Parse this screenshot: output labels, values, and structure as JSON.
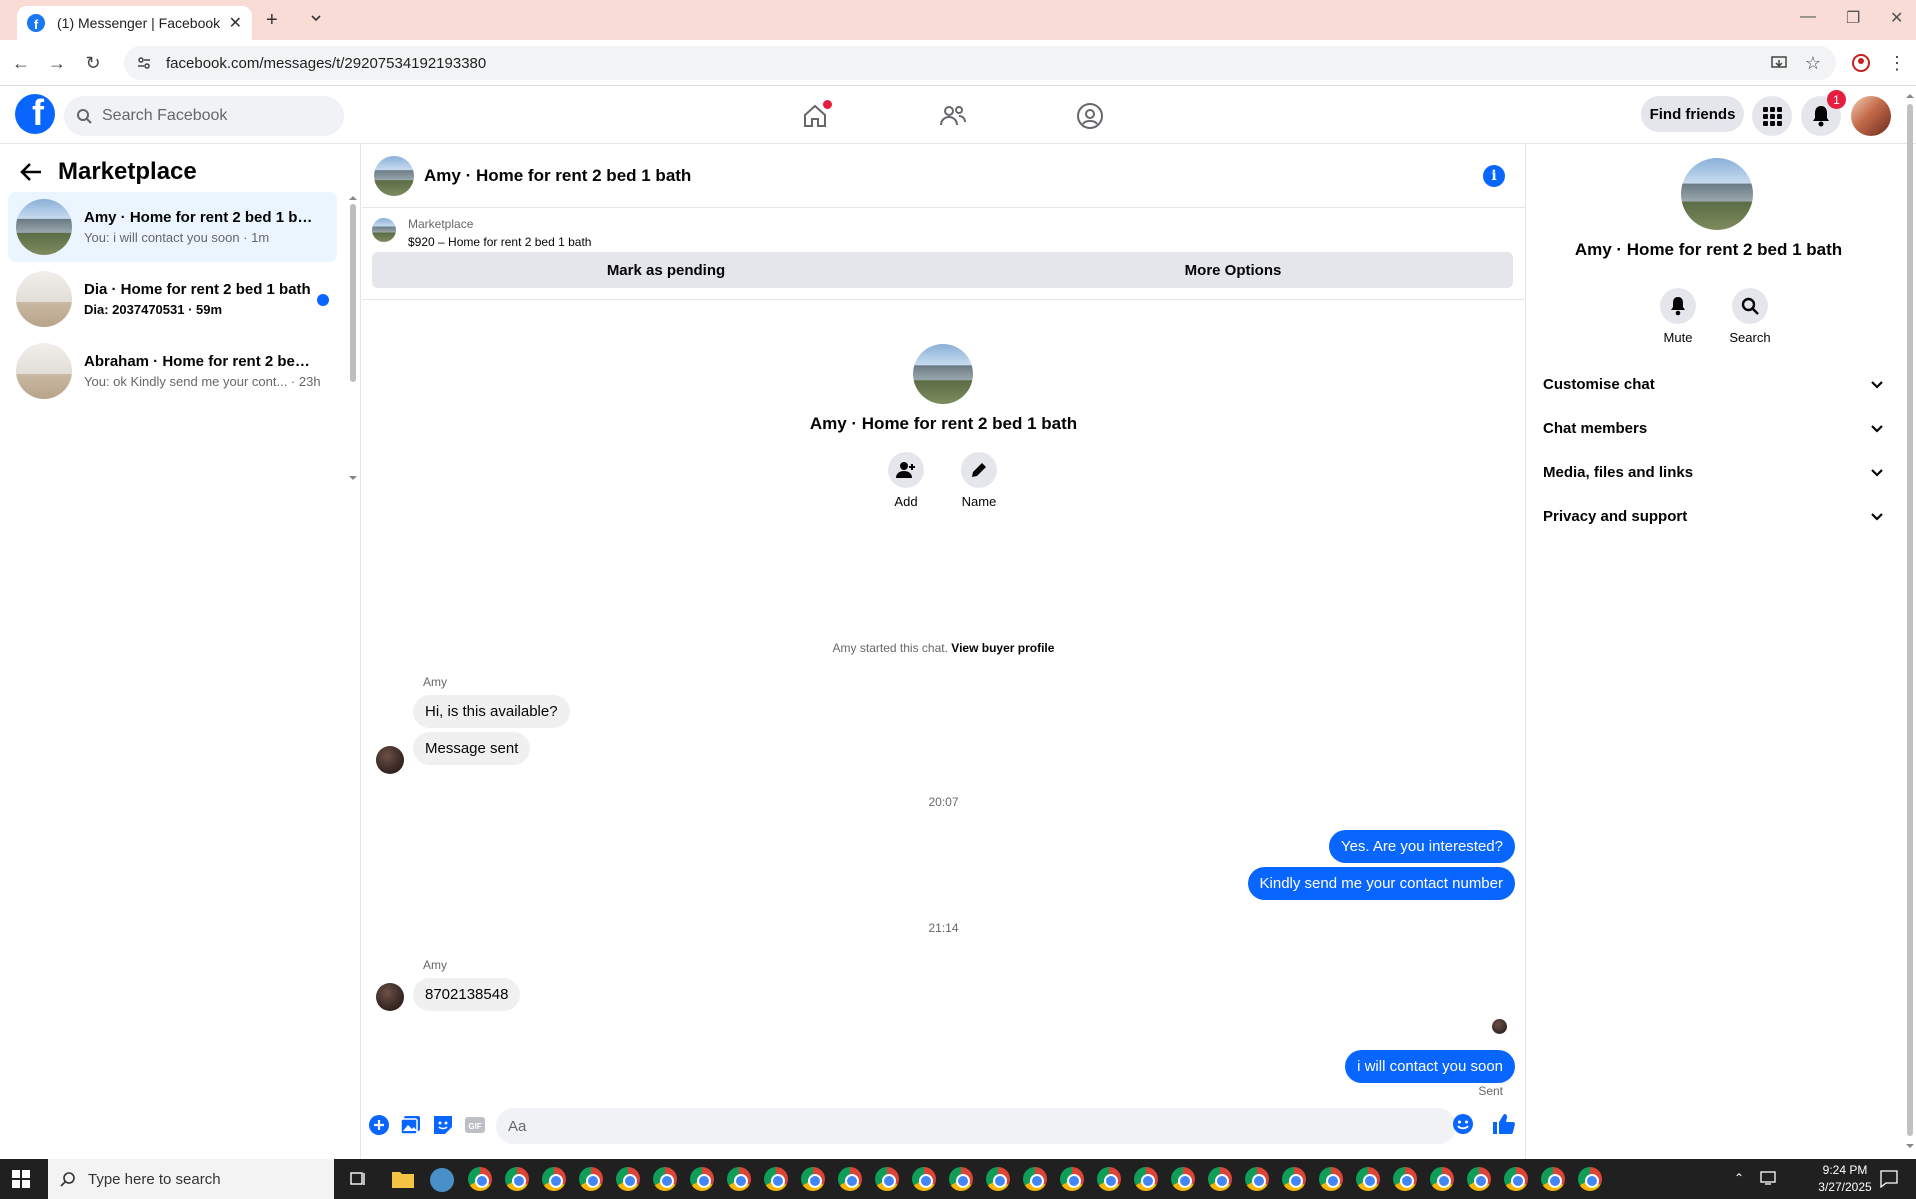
{
  "browser": {
    "tab_title": "(1) Messenger | Facebook",
    "url": "facebook.com/messages/t/29207534192193380"
  },
  "header": {
    "search_placeholder": "Search Facebook",
    "find_friends": "Find friends",
    "notification_count": "1"
  },
  "sidebar": {
    "title": "Marketplace",
    "conversations": [
      {
        "name": "Amy · Home for rent 2 bed 1 bath",
        "preview": "You: i will contact you soon · 1m",
        "active": true,
        "unread": false
      },
      {
        "name": "Dia · Home for rent 2 bed 1 bath",
        "preview": "Dia: 2037470531 · 59m",
        "active": false,
        "unread": true
      },
      {
        "name": "Abraham · Home for rent 2 bed ...",
        "preview": "You: ok Kindly send me your cont... · 23h",
        "active": false,
        "unread": false
      }
    ]
  },
  "chat": {
    "title": "Amy · Home for rent 2 bed 1 bath",
    "marketplace_label": "Marketplace",
    "listing": "$920 – Home for rent 2 bed 1 bath",
    "mark_pending": "Mark as pending",
    "more_options": "More Options",
    "intro_name": "Amy · Home for rent 2 bed 1 bath",
    "add_label": "Add",
    "name_label": "Name",
    "started_text": "Amy started this chat.",
    "buyer_profile": "View buyer profile",
    "sender_name": "Amy",
    "messages": {
      "m1": "Hi, is this available?",
      "m2": "Message sent",
      "time1": "20:07",
      "m3": "Yes. Are you interested?",
      "m4": "Kindly send me your contact number",
      "time2": "21:14",
      "m5": "8702138548",
      "m6": "i will contact you soon",
      "sent": "Sent"
    },
    "composer_placeholder": "Aa"
  },
  "details": {
    "title": "Amy · Home for rent 2 bed 1 bath",
    "mute": "Mute",
    "search": "Search",
    "sections": [
      "Customise chat",
      "Chat members",
      "Media, files and links",
      "Privacy and support"
    ]
  },
  "taskbar": {
    "search_placeholder": "Type here to search",
    "time": "9:24 PM",
    "date": "3/27/2025"
  },
  "colors": {
    "accent": "#0866ff",
    "unread": "#0866ff",
    "badge": "#e41e3f"
  }
}
